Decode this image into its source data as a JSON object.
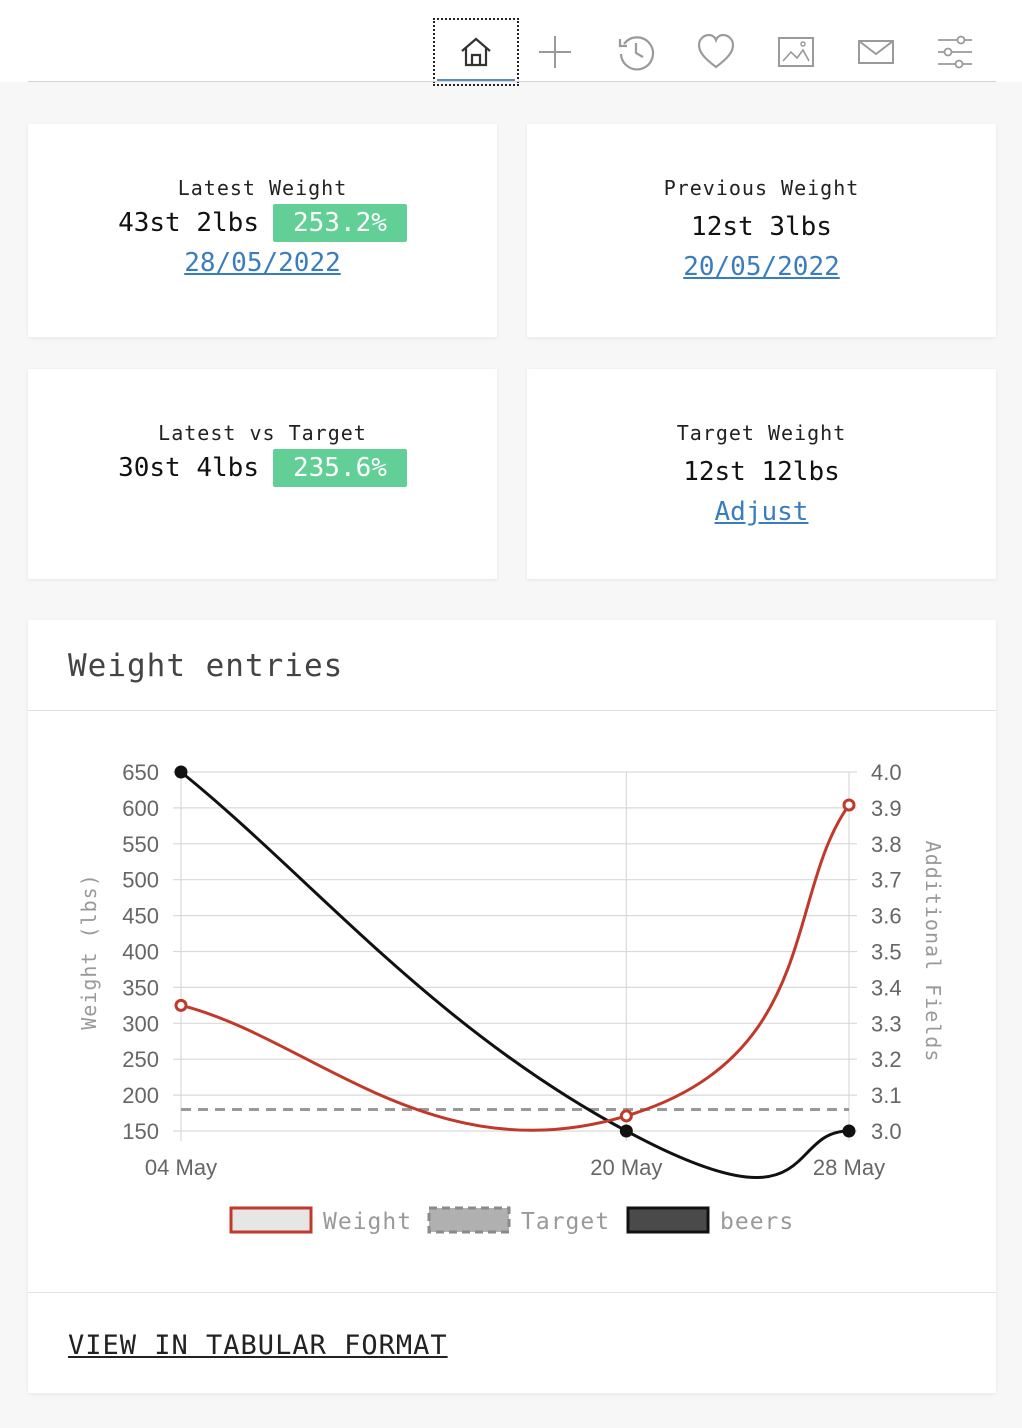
{
  "nav": {
    "items": [
      {
        "name": "home-icon",
        "active": true
      },
      {
        "name": "add-icon",
        "active": false
      },
      {
        "name": "history-icon",
        "active": false
      },
      {
        "name": "heart-icon",
        "active": false
      },
      {
        "name": "image-icon",
        "active": false
      },
      {
        "name": "mail-icon",
        "active": false
      },
      {
        "name": "sliders-icon",
        "active": false
      }
    ]
  },
  "cards": {
    "latest": {
      "label": "Latest Weight",
      "value": "43st 2lbs",
      "badge": "253.2%",
      "date": "28/05/2022"
    },
    "previous": {
      "label": "Previous Weight",
      "value": "12st 3lbs",
      "date": "20/05/2022"
    },
    "latest_vs_target": {
      "label": "Latest vs Target",
      "value": "30st 4lbs",
      "badge": "235.6%"
    },
    "target": {
      "label": "Target Weight",
      "value": "12st 12lbs",
      "link": "Adjust"
    }
  },
  "chart_section": {
    "title": "Weight entries",
    "tabular_link": "VIEW IN TABULAR FORMAT"
  },
  "colors": {
    "accent_badge": "#62cf97",
    "link": "#3a7dbf",
    "weight_series": "#c0392b",
    "target_series": "#999999",
    "beers_series": "#111111"
  },
  "chart_data": {
    "type": "line",
    "categories": [
      "04 May",
      "20 May",
      "28 May"
    ],
    "x": [
      4,
      20,
      28
    ],
    "ylabel": "Weight (lbs)",
    "y2label": "Additional Fields",
    "ylim": [
      150,
      650
    ],
    "y2lim": [
      3.0,
      4.0
    ],
    "yticks": [
      650,
      600,
      550,
      500,
      450,
      400,
      350,
      300,
      250,
      200,
      150
    ],
    "y2ticks": [
      "4.0",
      "3.9",
      "3.8",
      "3.7",
      "3.6",
      "3.5",
      "3.4",
      "3.3",
      "3.2",
      "3.1",
      "3.0"
    ],
    "grid": true,
    "legend_position": "bottom",
    "series": [
      {
        "name": "Weight",
        "axis": "left",
        "values": [
          325,
          171,
          604
        ]
      },
      {
        "name": "Target",
        "axis": "left",
        "values": [
          180,
          180,
          180
        ],
        "dashed": true
      },
      {
        "name": "beers",
        "axis": "right",
        "values": [
          4.0,
          3.0,
          3.0
        ]
      }
    ]
  }
}
